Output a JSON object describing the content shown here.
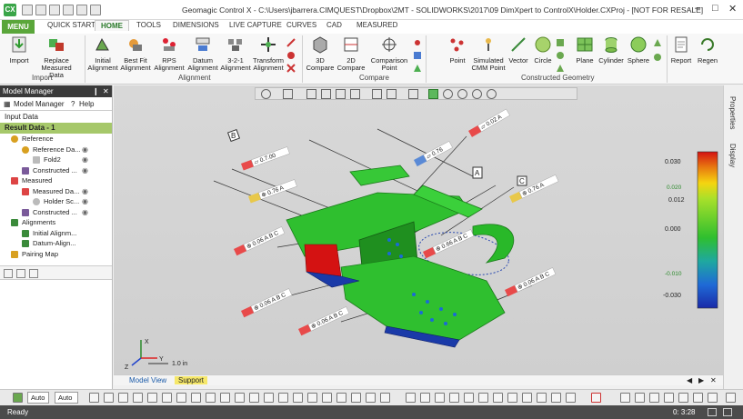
{
  "app": {
    "logo_text": "CX",
    "title": "Geomagic Control X - C:\\Users\\jbarrera.CIMQUEST\\Dropbox\\2MT - SOLIDWORKS\\2017\\09 DimXpert to ControlX\\Holder.CXProj - [NOT FOR RESALE]"
  },
  "tabs": {
    "menu": "MENU",
    "quick_start": "QUICK START",
    "home": "HOME",
    "tools": "TOOLS",
    "dimensions": "DIMENSIONS",
    "live_capture": "LIVE CAPTURE",
    "curves": "CURVES",
    "cad": "CAD",
    "measured": "MEASURED"
  },
  "ribbon": {
    "import": "Import",
    "replace": "Replace",
    "replace2": "Measured Data",
    "initial": "Initial",
    "initial2": "Alignment",
    "bestfit": "Best Fit",
    "bestfit2": "Alignment",
    "rps": "RPS",
    "rps2": "Alignment",
    "datum": "Datum",
    "datum2": "Alignment",
    "three21": "3-2-1",
    "three212": "Alignment",
    "transform": "Transform",
    "transform2": "Alignment",
    "compare3d": "3D",
    "compare3d2": "Compare",
    "compare2d": "2D",
    "compare2d2": "Compare",
    "comparison": "Comparison",
    "comparison2": "Point",
    "point": "Point",
    "simulated": "Simulated",
    "simulated2": "CMM Point",
    "vector": "Vector",
    "circle": "Circle",
    "plane": "Plane",
    "cylinder": "Cylinder",
    "sphere": "Sphere",
    "report": "Report",
    "regen": "Regen",
    "g_import": "Import",
    "g_alignment": "Alignment",
    "g_compare": "Compare",
    "g_constructed": "Constructed Geometry"
  },
  "panel": {
    "title": "Model Manager",
    "tab_model": "Model Manager",
    "tab_help": "Help",
    "input_data": "Input Data",
    "result_data": "Result Data - 1",
    "tree": [
      {
        "label": "Reference",
        "indent": 0
      },
      {
        "label": "Reference Da...",
        "indent": 1
      },
      {
        "label": "Fold2",
        "indent": 2
      },
      {
        "label": "Constructed ...",
        "indent": 1
      },
      {
        "label": "Measured",
        "indent": 0
      },
      {
        "label": "Measured Da...",
        "indent": 1
      },
      {
        "label": "Holder Sc...",
        "indent": 2
      },
      {
        "label": "Constructed ...",
        "indent": 1
      },
      {
        "label": "Alignments",
        "indent": 0
      },
      {
        "label": "Initial Alignm...",
        "indent": 1
      },
      {
        "label": "Datum-Align...",
        "indent": 1
      },
      {
        "label": "Pairing Map",
        "indent": 0
      }
    ]
  },
  "viewport": {
    "scale_label": "1.0 in",
    "callouts": {
      "c1": "▱ 0.7.00",
      "c2": "⊕ 0.76 A",
      "c3": "▱ 0.76",
      "c4": "▱ 0.02 A",
      "c5": "⊕ 0.76 A",
      "c6": "⊕ 0.06 A B C",
      "c7": "⊕ 0.66 A B C",
      "c8": "⊕ 0.06 A B C",
      "c9": "⊕ 0.06 A B C",
      "c10": "⊕ 0.06 A B C",
      "datum_a": "A",
      "datum_b": "B",
      "datum_c": "C"
    },
    "axis_x": "X",
    "axis_y": "Y",
    "axis_z": "Z"
  },
  "colorbar": {
    "labels": [
      "0.030",
      "0.012",
      "0.000",
      "-0.030"
    ],
    "mark_top": "0.020",
    "mark_low": "-0.010",
    "colors": [
      "#d41212",
      "#e87a10",
      "#f5d510",
      "#a8e02a",
      "#2fbf2f",
      "#1fa8a0",
      "#1f6ad6",
      "#1a2aa8"
    ]
  },
  "dock": {
    "properties": "Properties",
    "display": "Display"
  },
  "bottom_tabs": {
    "model_view": "Model View",
    "support": "Support"
  },
  "bottom_toolbar": {
    "sel1": "Auto",
    "sel2": "Auto"
  },
  "status": {
    "ready": "Ready",
    "coords": "0: 3:28"
  }
}
